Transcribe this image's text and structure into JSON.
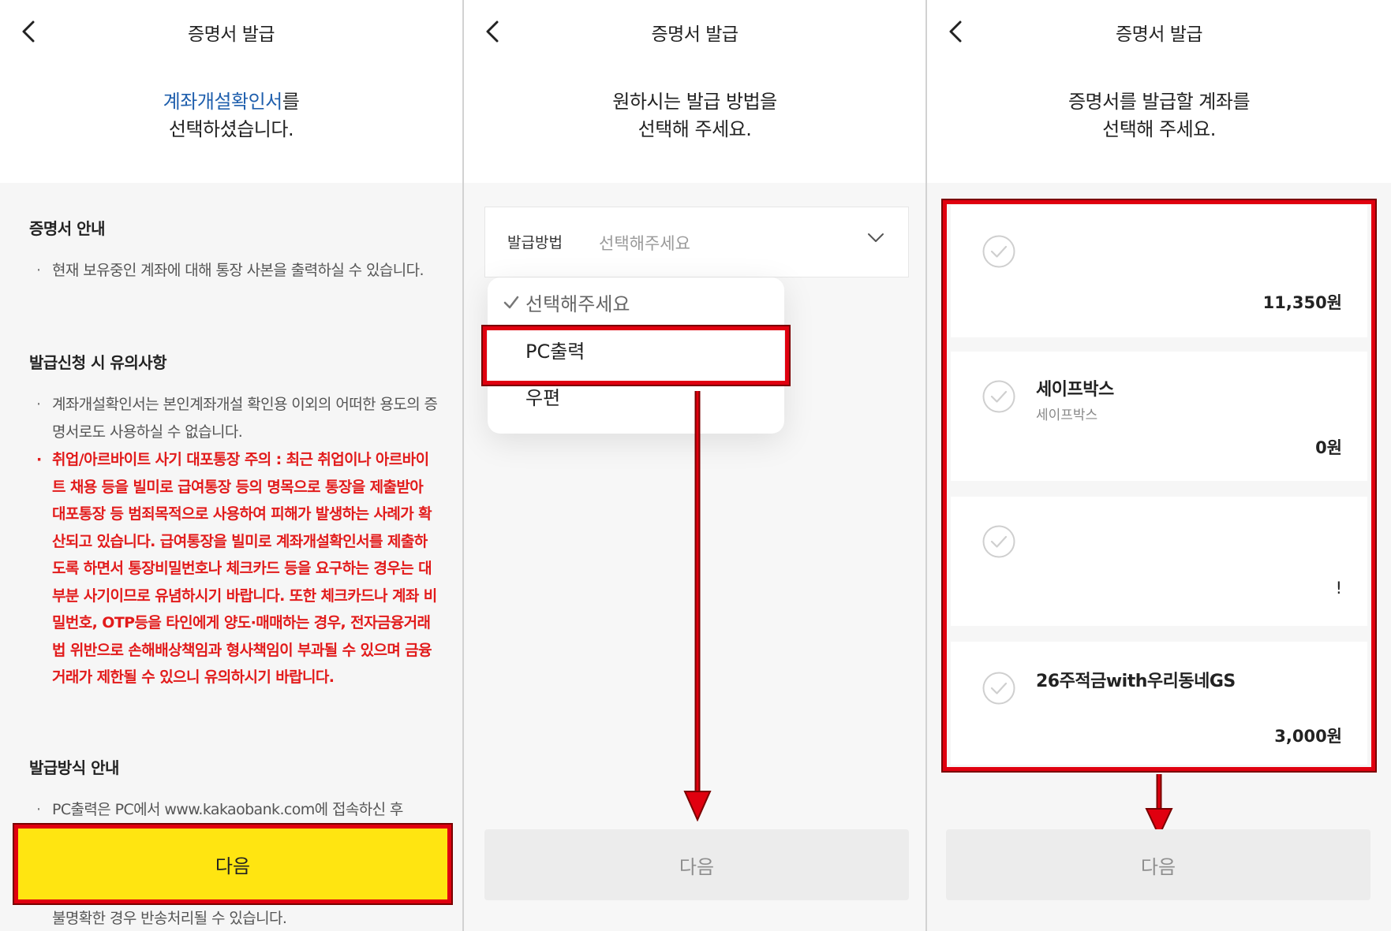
{
  "panel1": {
    "header_title": "증명서 발급",
    "headline_highlight": "계좌개설확인서",
    "headline_suffix": "를",
    "headline_line2": "선택하셨습니다.",
    "section1_title": "증명서 안내",
    "section1_bullet": "현재 보유중인 계좌에 대해 통장 사본을 출력하실 수 있습니다.",
    "section2_title": "발급신청 시 유의사항",
    "section2_bullet1": "계좌개설확인서는 본인계좌개설 확인용 이외의 어떠한 용도의 증명서로도 사용하실 수 없습니다.",
    "section2_bullet2": "취업/아르바이트 사기 대포통장 주의 : 최근 취업이나 아르바이트 채용 등을 빌미로 급여통장 등의 명목으로 통장을 제출받아 대포통장 등 범죄목적으로 사용하여 피해가 발생하는 사례가 확산되고 있습니다. 급여통장을 빌미로 계좌개설확인서를 제출하도록 하면서 통장비밀번호나 체크카드 등을 요구하는 경우는 대부분 사기이므로 유념하시기 바랍니다. 또한 체크카드나 계좌 비밀번호, OTP등을 타인에게 양도·매매하는 경우, 전자금융거래법 위반으로 손해배상책임과 형사책임이 부과될 수 있으며 금융거래가 제한될 수 있으니 유의하시기 바랍니다.",
    "section3_title": "발급방식 안내",
    "section3_bullet": "PC출력은 PC에서 www.kakaobank.com에 접속하신 후",
    "next_button": "다음",
    "footer_note": "불명확한 경우 반송처리될 수 있습니다."
  },
  "panel2": {
    "header_title": "증명서 발급",
    "headline_line1": "원하시는 발급 방법을",
    "headline_line2": "선택해 주세요.",
    "select_label": "발급방법",
    "select_value": "선택해주세요",
    "options": [
      "선택해주세요",
      "PC출력",
      "우편"
    ],
    "next_button": "다음"
  },
  "panel3": {
    "header_title": "증명서 발급",
    "headline_line1": "증명서를 발급할 계좌를",
    "headline_line2": "선택해 주세요.",
    "accounts": [
      {
        "name": "",
        "sub": "",
        "amount": "11,350원"
      },
      {
        "name": "세이프박스",
        "sub": "세이프박스",
        "amount": "0원"
      },
      {
        "name": "",
        "sub": "",
        "amount": "!"
      },
      {
        "name": "26주적금with우리동네GS",
        "sub": "",
        "amount": "3,000원"
      }
    ],
    "next_button": "다음"
  },
  "colors": {
    "yellow": "#ffe511",
    "highlight_red": "#e0000f",
    "warning_red": "#e21b1b",
    "link_blue": "#1f5fad"
  }
}
